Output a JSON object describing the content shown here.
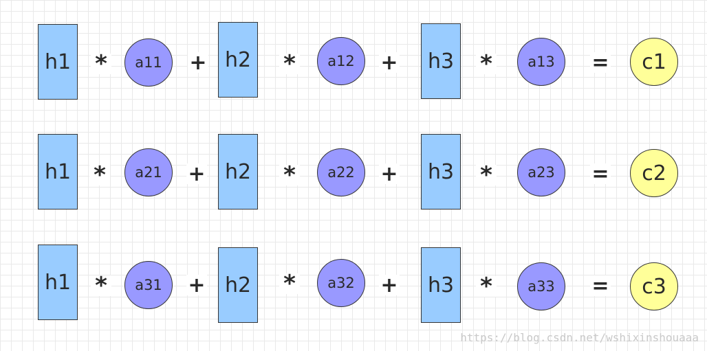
{
  "rows": [
    {
      "terms": [
        {
          "h": "h1",
          "a": "a11"
        },
        {
          "h": "h2",
          "a": "a12"
        },
        {
          "h": "h3",
          "a": "a13"
        }
      ],
      "result": "c1"
    },
    {
      "terms": [
        {
          "h": "h1",
          "a": "a21"
        },
        {
          "h": "h2",
          "a": "a22"
        },
        {
          "h": "h3",
          "a": "a23"
        }
      ],
      "result": "c2"
    },
    {
      "terms": [
        {
          "h": "h1",
          "a": "a31"
        },
        {
          "h": "h2",
          "a": "a32"
        },
        {
          "h": "h3",
          "a": "a33"
        }
      ],
      "result": "c3"
    }
  ],
  "operators": {
    "multiply": "*",
    "plus": "+",
    "equals": "="
  },
  "colors": {
    "h_box": "#99ccff",
    "a_circle": "#9999ff",
    "c_circle": "#ffff99",
    "grid": "#e9e9e9"
  },
  "watermark": "https://blog.csdn.net/wshixinshouaaa"
}
